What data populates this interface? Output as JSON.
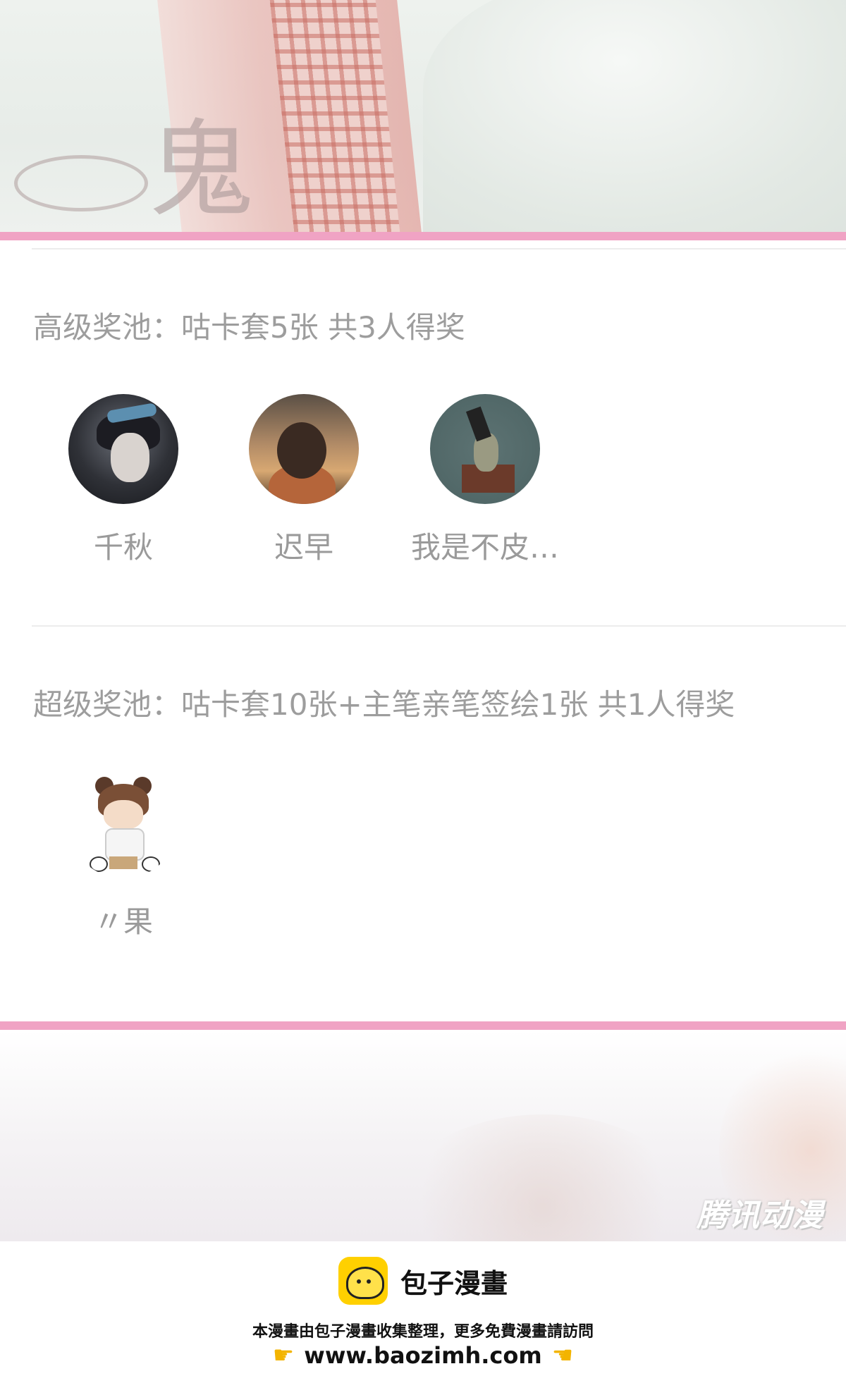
{
  "banner": {
    "calligraphy_char": "鬼"
  },
  "prize_pools": [
    {
      "title": "高级奖池：咕卡套5张 共3人得奖",
      "winners": [
        {
          "name": "千秋",
          "avatar": "avatar-boy-dark"
        },
        {
          "name": "迟早",
          "avatar": "avatar-girl-sunset"
        },
        {
          "name": "我是不皮…",
          "avatar": "avatar-girl-box"
        }
      ]
    },
    {
      "title": "超级奖池：咕卡套10张+主笔亲笔签绘1张 共1人得奖",
      "winners": [
        {
          "name": "〃果",
          "avatar": "avatar-chibi-bear"
        }
      ]
    }
  ],
  "watermark": "腾讯动漫",
  "footer": {
    "logo_text": "包子漫畫",
    "note": "本漫畫由包子漫畫收集整理，更多免費漫畫請訪問",
    "url": "www.baozimh.com",
    "left_icon": "pointing-right-hand-icon",
    "right_icon": "pointing-left-hand-icon"
  },
  "colors": {
    "accent_rule": "#f0a3c4",
    "title_text": "#9d9d9d",
    "logo_bg": "#ffd000"
  }
}
